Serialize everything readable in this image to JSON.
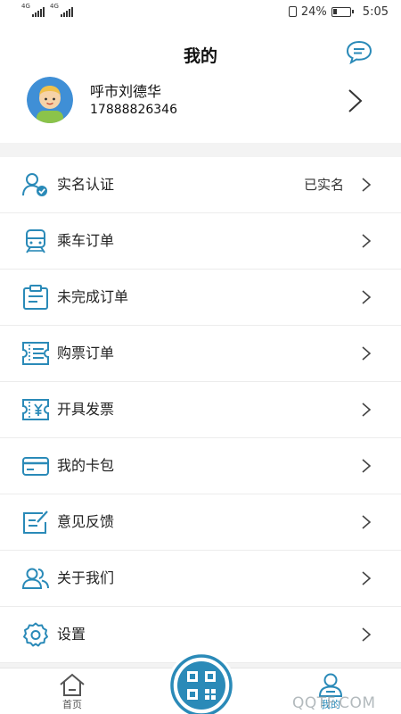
{
  "status_bar": {
    "net1": "4G",
    "net2": "4G",
    "battery": "24%",
    "time": "5:05"
  },
  "header": {
    "title": "我的"
  },
  "profile": {
    "name": "呼市刘德华",
    "phone": "17888826346"
  },
  "menu": [
    {
      "label": "实名认证",
      "value": "已实名",
      "icon": "verified-user-icon"
    },
    {
      "label": "乘车订单",
      "value": "",
      "icon": "train-icon"
    },
    {
      "label": "未完成订单",
      "value": "",
      "icon": "clipboard-icon"
    },
    {
      "label": "购票订单",
      "value": "",
      "icon": "ticket-list-icon"
    },
    {
      "label": "开具发票",
      "value": "",
      "icon": "invoice-icon"
    },
    {
      "label": "我的卡包",
      "value": "",
      "icon": "card-icon"
    },
    {
      "label": "意见反馈",
      "value": "",
      "icon": "feedback-icon"
    },
    {
      "label": "关于我们",
      "value": "",
      "icon": "people-icon"
    },
    {
      "label": "设置",
      "value": "",
      "icon": "gear-icon"
    }
  ],
  "bottom_nav": {
    "home_label": "首页",
    "me_label": "我的"
  },
  "watermark": "QQTF.COM",
  "colors": {
    "accent": "#2a8ab8",
    "background": "#f3f3f3"
  }
}
